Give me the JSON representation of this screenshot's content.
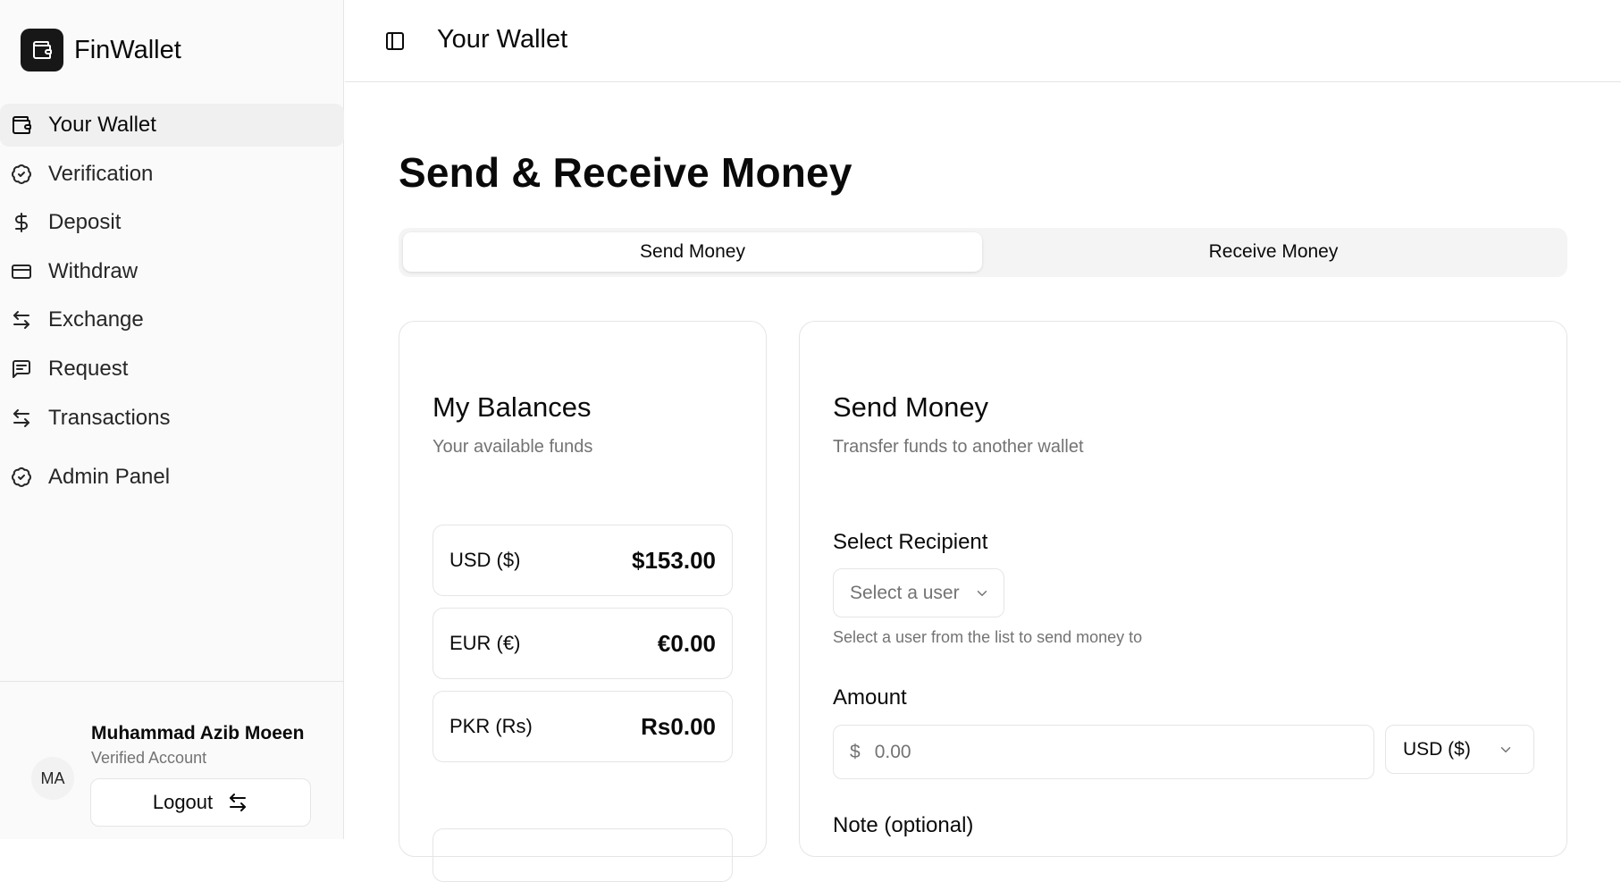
{
  "sidebar": {
    "brand": "FinWallet",
    "items": [
      {
        "label": "Your Wallet",
        "icon": "wallet-icon",
        "active": true
      },
      {
        "label": "Verification",
        "icon": "badge-check-icon"
      },
      {
        "label": "Deposit",
        "icon": "dollar-icon"
      },
      {
        "label": "Withdraw",
        "icon": "credit-card-icon"
      },
      {
        "label": "Exchange",
        "icon": "arrows-exchange-icon"
      },
      {
        "label": "Request",
        "icon": "message-icon"
      },
      {
        "label": "Transactions",
        "icon": "arrows-exchange-icon"
      },
      {
        "label": "Admin Panel",
        "icon": "badge-check-icon"
      }
    ],
    "user": {
      "initials": "MA",
      "name": "Muhammad Azib Moeen",
      "status": "Verified Account",
      "logout_label": "Logout"
    }
  },
  "header": {
    "title": "Your Wallet"
  },
  "main": {
    "title": "Send & Receive Money",
    "tabs": [
      {
        "label": "Send Money",
        "active": true
      },
      {
        "label": "Receive Money",
        "active": false
      }
    ],
    "balances": {
      "title": "My Balances",
      "subtitle": "Your available funds",
      "rows": [
        {
          "currency": "USD ($)",
          "amount": "$153.00"
        },
        {
          "currency": "EUR (€)",
          "amount": "€0.00"
        },
        {
          "currency": "PKR (Rs)",
          "amount": "Rs0.00"
        }
      ]
    },
    "send": {
      "title": "Send Money",
      "subtitle": "Transfer funds to another wallet",
      "recipient_label": "Select Recipient",
      "recipient_placeholder": "Select a user",
      "recipient_hint": "Select a user from the list to send money to",
      "amount_label": "Amount",
      "amount_prefix": "$",
      "amount_placeholder": "0.00",
      "currency_selected": "USD ($)",
      "note_label": "Note (optional)"
    }
  },
  "colors": {
    "primary": "#171717",
    "muted_text": "#737373",
    "border": "#e5e5e5",
    "sidebar_bg": "#fafafa",
    "tabs_bg": "#f4f4f4"
  }
}
